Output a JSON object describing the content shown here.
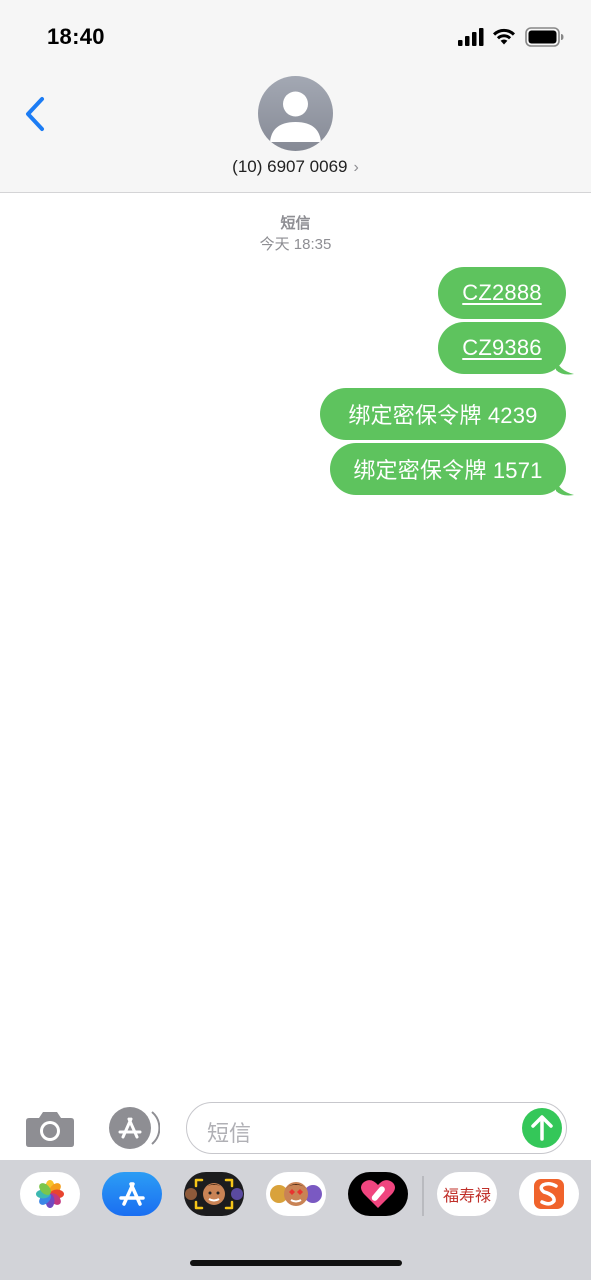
{
  "status_bar": {
    "time": "18:40"
  },
  "header": {
    "contact": "(10) 6907 0069"
  },
  "conversation": {
    "service": "短信",
    "timestamp": "今天 18:35",
    "messages": [
      {
        "text": "CZ2888",
        "type": "code"
      },
      {
        "text": "CZ9386",
        "type": "code"
      },
      {
        "text": "绑定密保令牌 4239",
        "type": "text"
      },
      {
        "text": "绑定密保令牌 1571",
        "type": "text"
      }
    ]
  },
  "input": {
    "placeholder": "短信"
  },
  "app_drawer": {
    "apps": [
      "photos-app",
      "app-store-app",
      "memoji-app",
      "memoji-stickers-app",
      "digital-touch-app",
      "calligraphy-app",
      "sogou-app"
    ],
    "calligraphy_text": "福寿禄"
  },
  "colors": {
    "bubble": "#5ec35e",
    "accent": "#1c7cf4",
    "send": "#34c759"
  }
}
